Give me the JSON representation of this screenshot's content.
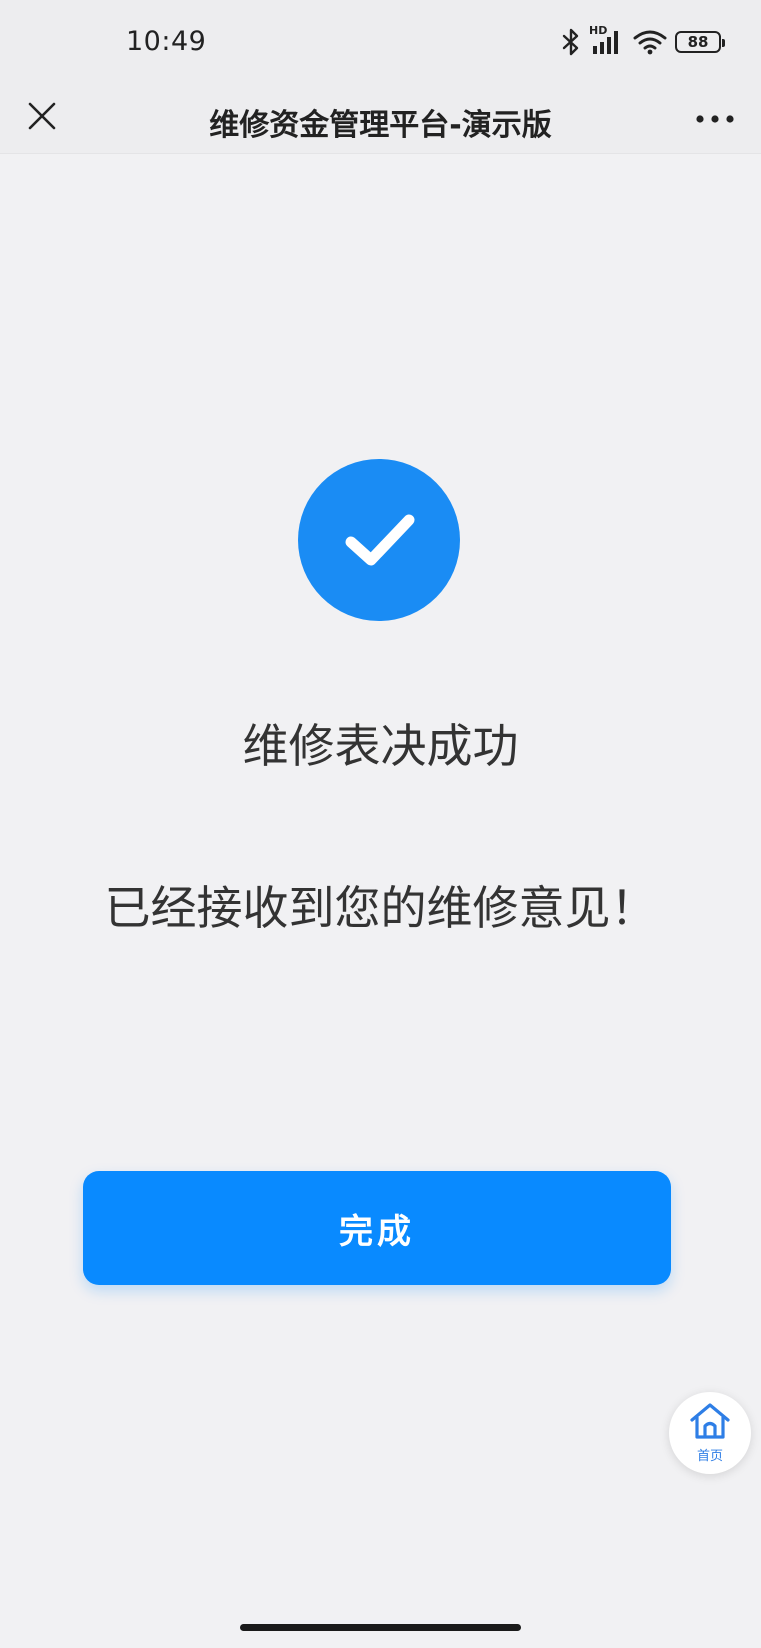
{
  "status_bar": {
    "time": "10:49",
    "network_label": "HD",
    "battery_level": "88",
    "icons": [
      "bluetooth-icon",
      "cellular-signal-icon",
      "wifi-icon",
      "battery-icon"
    ]
  },
  "header": {
    "title": "维修资金管理平台-演示版",
    "close_icon": "close-icon",
    "more_icon": "more-icon"
  },
  "result": {
    "icon": "check-circle-icon",
    "title": "维修表决成功",
    "message": "已经接收到您的维修意见！"
  },
  "actions": {
    "done_label": "完成"
  },
  "floating_home": {
    "icon": "home-icon",
    "label": "首页"
  },
  "colors": {
    "accent": "#098aff",
    "success_icon_bg": "#1a8cf4",
    "background": "#f1f1f3",
    "home_label": "#2e7ee6"
  }
}
